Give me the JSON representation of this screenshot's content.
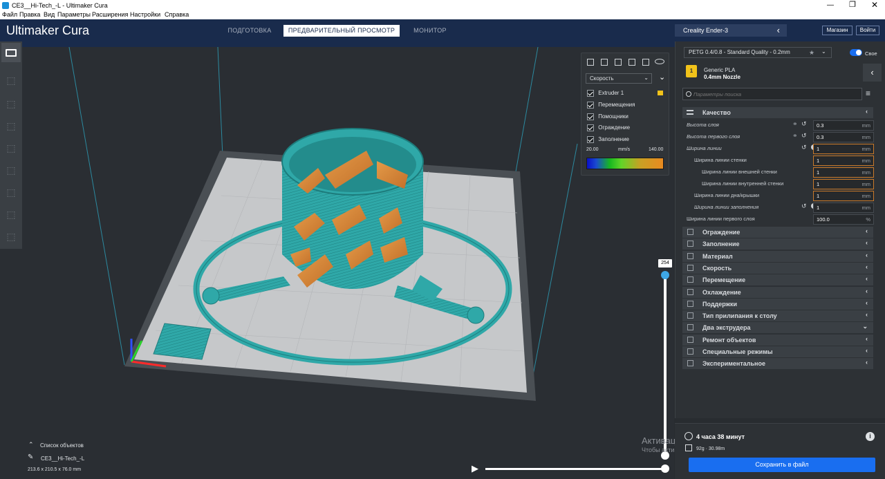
{
  "window": {
    "title": "CE3__Hi-Tech_-L - Ultimaker Cura"
  },
  "menu": [
    "Файл",
    "Правка",
    "Вид",
    "Параметры",
    "Расширения",
    "Настройки",
    "Справка"
  ],
  "header": {
    "logo": "Ultimaker Cura",
    "tabs": [
      "ПОДГОТОВКА",
      "ПРЕДВАРИТЕЛЬНЫЙ ПРОСМОТР",
      "МОНИТОР"
    ],
    "active_tab": 1,
    "printer": "Creality Ender-3",
    "shop_btn": "Магазин",
    "login_btn": "Войти"
  },
  "view_panel": {
    "color_scheme": "Скорость",
    "items": [
      "Extruder 1",
      "Перемещения",
      "Помощники",
      "Ограждение",
      "Заполнение"
    ],
    "legend_min": "20.00",
    "legend_unit": "mm/s",
    "legend_max": "140.00"
  },
  "layer_slider": {
    "top_value": "254"
  },
  "settings": {
    "profile": "PETG 0.4/0.8 - Standard Quality - 0.2mm",
    "custom_toggle": "Свое",
    "material": "Generic PLA",
    "nozzle": "0.4mm Nozzle",
    "search_placeholder": "Параметры поиска",
    "quality_category": "Качество",
    "rows": [
      {
        "label": "Высота слоя",
        "value": "0.3",
        "unit": "mm",
        "indent": 0,
        "italic": true,
        "link": true,
        "reset": true,
        "info": false,
        "hl": false
      },
      {
        "label": "Высота первого слоя",
        "value": "0.3",
        "unit": "mm",
        "indent": 0,
        "italic": true,
        "link": true,
        "reset": true,
        "info": false,
        "hl": false
      },
      {
        "label": "Ширина линии",
        "value": "1",
        "unit": "mm",
        "indent": 0,
        "italic": true,
        "link": false,
        "reset": true,
        "info": true,
        "hl": true
      },
      {
        "label": "Ширина линии стенки",
        "value": "1",
        "unit": "mm",
        "indent": 1,
        "italic": false,
        "link": false,
        "reset": false,
        "info": false,
        "hl": true
      },
      {
        "label": "Ширина линии внешней стенки",
        "value": "1",
        "unit": "mm",
        "indent": 2,
        "italic": false,
        "link": false,
        "reset": false,
        "info": false,
        "hl": true
      },
      {
        "label": "Ширина линии внутренней стенки",
        "value": "1",
        "unit": "mm",
        "indent": 2,
        "italic": false,
        "link": false,
        "reset": false,
        "info": false,
        "hl": true
      },
      {
        "label": "Ширина линии дна/крышки",
        "value": "1",
        "unit": "mm",
        "indent": 1,
        "italic": false,
        "link": false,
        "reset": false,
        "info": false,
        "hl": true
      },
      {
        "label": "Ширина линии заполнения",
        "value": "1",
        "unit": "mm",
        "indent": 1,
        "italic": true,
        "link": false,
        "reset": true,
        "info": true,
        "hl": false
      },
      {
        "label": "Ширина линии первого слоя",
        "value": "100.0",
        "unit": "%",
        "indent": 0,
        "italic": false,
        "link": false,
        "reset": false,
        "info": false,
        "hl": false
      }
    ],
    "categories": [
      {
        "label": "Ограждение",
        "icon": "skirt-icon",
        "chev": "‹"
      },
      {
        "label": "Заполнение",
        "icon": "infill-icon",
        "chev": "‹"
      },
      {
        "label": "Материал",
        "icon": "material-icon",
        "chev": "‹"
      },
      {
        "label": "Скорость",
        "icon": "speed-icon",
        "chev": "‹"
      },
      {
        "label": "Перемещение",
        "icon": "travel-icon",
        "chev": "‹"
      },
      {
        "label": "Охлаждение",
        "icon": "cooling-icon",
        "chev": "‹"
      },
      {
        "label": "Поддержки",
        "icon": "support-icon",
        "chev": "‹"
      },
      {
        "label": "Тип прилипания к столу",
        "icon": "adhesion-icon",
        "chev": "‹"
      },
      {
        "label": "Два экструдера",
        "icon": "dual-extruder-icon",
        "chev": "⌄"
      },
      {
        "label": "Ремонт объектов",
        "icon": "mesh-fix-icon",
        "chev": "‹"
      },
      {
        "label": "Специальные режимы",
        "icon": "special-modes-icon",
        "chev": "‹"
      },
      {
        "label": "Экспериментальное",
        "icon": "experimental-icon",
        "chev": "‹"
      }
    ]
  },
  "objects": {
    "list_label": "Список объектов",
    "object_name": "CE3__Hi-Tech_-L",
    "dimensions": "213.6 x 210.5 x 76.0 mm"
  },
  "print_info": {
    "time": "4 часа 38 минут",
    "material": "92g · 30.98m",
    "save_btn": "Сохранить в файл"
  },
  "watermark": {
    "line1": "Активация Windows",
    "line2": "Чтобы активировать Windows, перейдите в раздел \"Параметры\"."
  },
  "colors": {
    "accent": "#196ef0",
    "header": "#192b4c",
    "model": "#2fa8a8",
    "infill": "#d98a3a",
    "highlight": "#c97a2a"
  }
}
